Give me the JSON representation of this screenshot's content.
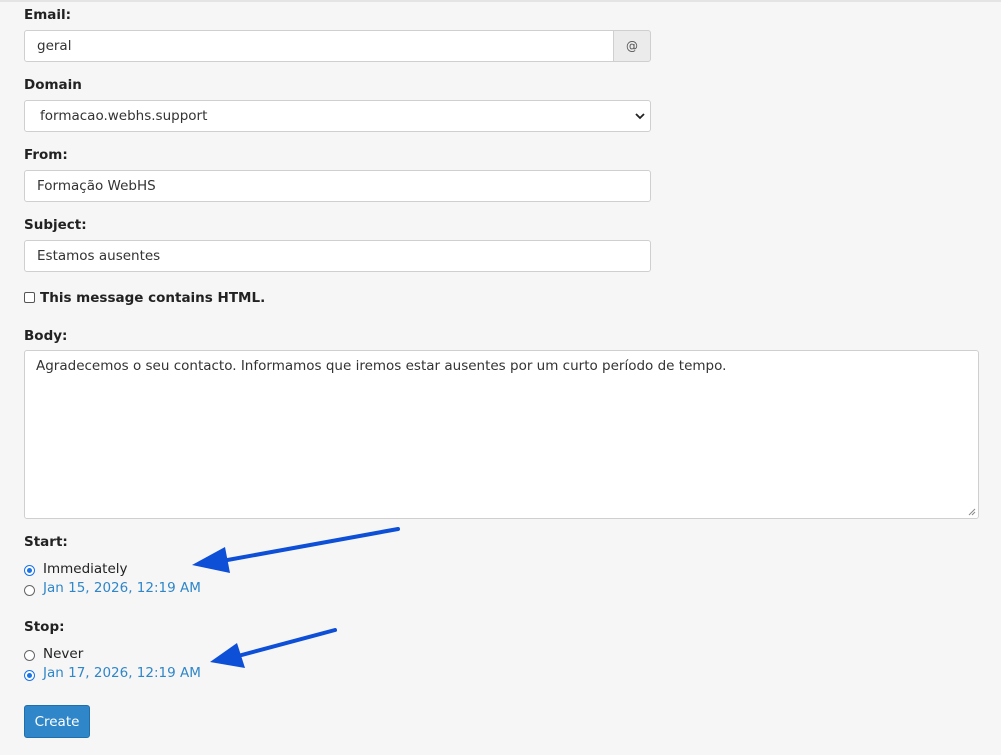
{
  "form": {
    "email": {
      "label": "Email:",
      "value": "geral",
      "addon": "@"
    },
    "domain": {
      "label": "Domain",
      "selected": "formacao.webhs.support"
    },
    "from": {
      "label": "From:",
      "value": "Formação WebHS"
    },
    "subject": {
      "label": "Subject:",
      "value": "Estamos ausentes"
    },
    "html_checkbox": {
      "label": "This message contains HTML.",
      "checked": false
    },
    "body": {
      "label": "Body:",
      "value": "Agradecemos o seu contacto. Informamos que iremos estar ausentes por um curto período de tempo."
    },
    "start": {
      "label": "Start:",
      "options": [
        {
          "label": "Immediately",
          "checked": true
        },
        {
          "label": "Jan 15, 2026, 12:19 AM",
          "checked": false
        }
      ]
    },
    "stop": {
      "label": "Stop:",
      "options": [
        {
          "label": "Never",
          "checked": false
        },
        {
          "label": "Jan 17, 2026, 12:19 AM",
          "checked": true
        }
      ]
    },
    "create_button": "Create"
  },
  "colors": {
    "accent": "#2f86c8",
    "arrow": "#0d4fd6",
    "background": "#f6f6f6"
  }
}
